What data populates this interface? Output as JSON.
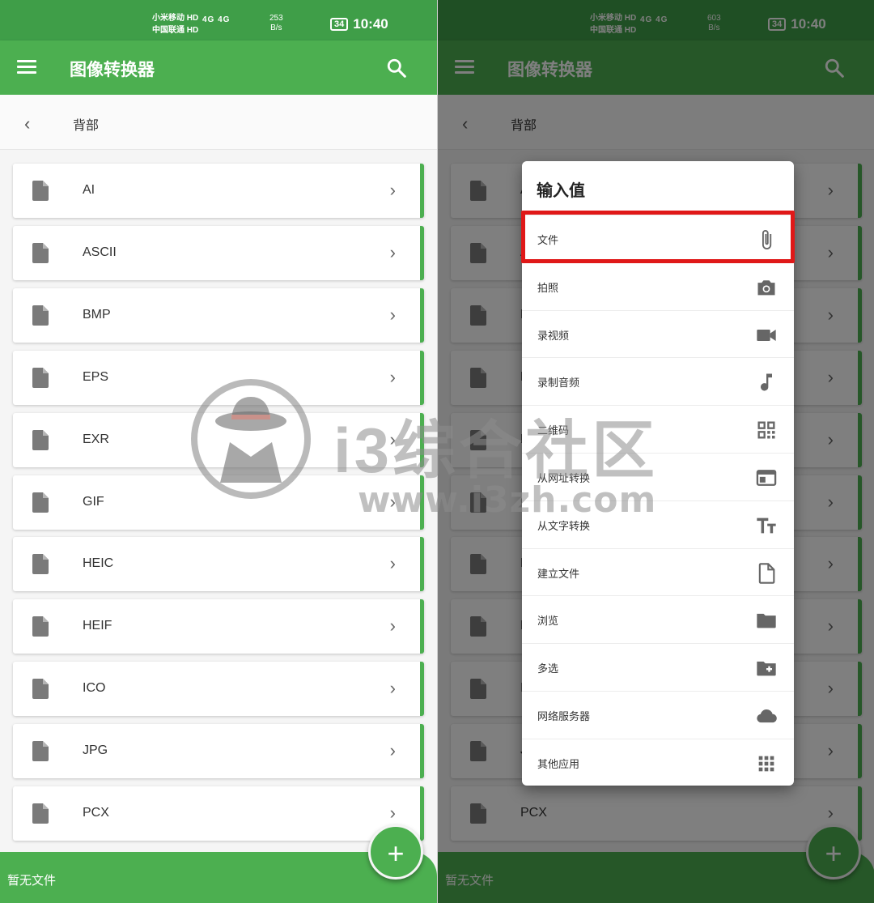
{
  "status_bar": {
    "carrier1": "小米移动",
    "carrier2": "中国联通",
    "hd": "HD",
    "signal": "4G 4G",
    "speed_left": "253",
    "speed_right": "603",
    "speed_unit": "B/s",
    "battery": "34",
    "time": "10:40"
  },
  "app_bar": {
    "title": "图像转换器"
  },
  "back_row": {
    "label": "背部"
  },
  "formats": [
    "AI",
    "ASCII",
    "BMP",
    "EPS",
    "EXR",
    "GIF",
    "HEIC",
    "HEIF",
    "ICO",
    "JPG",
    "PCX"
  ],
  "bottom_bar": {
    "label": "暂无文件",
    "fab_label": "+"
  },
  "dialog": {
    "title": "输入值",
    "options": [
      {
        "label": "文件",
        "icon": "paperclip-icon"
      },
      {
        "label": "拍照",
        "icon": "camera-icon"
      },
      {
        "label": "录视频",
        "icon": "videocam-icon"
      },
      {
        "label": "录制音频",
        "icon": "music-note-icon"
      },
      {
        "label": "二维码",
        "icon": "qr-code-icon"
      },
      {
        "label": "从网址转换",
        "icon": "web-window-icon"
      },
      {
        "label": "从文字转换",
        "icon": "text-size-icon"
      },
      {
        "label": "建立文件",
        "icon": "new-file-icon"
      },
      {
        "label": "浏览",
        "icon": "folder-icon"
      },
      {
        "label": "多选",
        "icon": "folder-plus-icon"
      },
      {
        "label": "网络服务器",
        "icon": "cloud-icon"
      },
      {
        "label": "其他应用",
        "icon": "apps-grid-icon"
      }
    ]
  },
  "watermark": {
    "text": "i3综合社区",
    "url": "www.i3zh.com"
  },
  "colors": {
    "primary": "#4caf50",
    "primary_dark": "#3f9e48",
    "highlight": "#e01818"
  }
}
